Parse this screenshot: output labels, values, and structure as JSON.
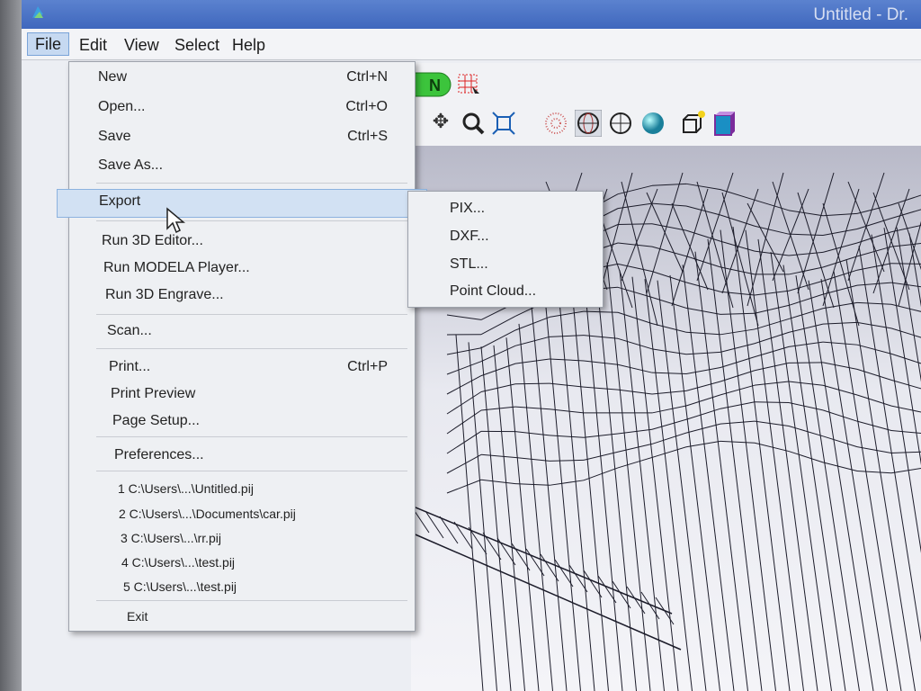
{
  "window": {
    "title": "Untitled - Dr."
  },
  "menubar": {
    "items": [
      "File",
      "Edit",
      "View",
      "Select",
      "Help"
    ],
    "active": "File"
  },
  "file_menu": {
    "items": [
      {
        "label": "New",
        "shortcut": "Ctrl+N"
      },
      {
        "label": "Open...",
        "shortcut": "Ctrl+O"
      },
      {
        "label": "Save",
        "shortcut": "Ctrl+S"
      },
      {
        "label": "Save As...",
        "shortcut": ""
      },
      {
        "label": "Export",
        "shortcut": "",
        "has_submenu": true
      },
      {
        "label": "Run 3D Editor...",
        "shortcut": ""
      },
      {
        "label": "Run MODELA Player...",
        "shortcut": ""
      },
      {
        "label": "Run 3D Engrave...",
        "shortcut": ""
      },
      {
        "label": "Scan...",
        "shortcut": ""
      },
      {
        "label": "Print...",
        "shortcut": "Ctrl+P"
      },
      {
        "label": "Print Preview",
        "shortcut": ""
      },
      {
        "label": "Page Setup...",
        "shortcut": ""
      },
      {
        "label": "Preferences...",
        "shortcut": ""
      },
      {
        "label": "1 C:\\Users\\...\\Untitled.pij",
        "shortcut": ""
      },
      {
        "label": "2 C:\\Users\\...\\Documents\\car.pij",
        "shortcut": ""
      },
      {
        "label": "3 C:\\Users\\...\\rr.pij",
        "shortcut": ""
      },
      {
        "label": "4 C:\\Users\\...\\test.pij",
        "shortcut": ""
      },
      {
        "label": "5 C:\\Users\\...\\test.pij",
        "shortcut": ""
      },
      {
        "label": "Exit",
        "shortcut": ""
      }
    ]
  },
  "export_submenu": {
    "items": [
      "PIX...",
      "DXF...",
      "STL...",
      "Point Cloud..."
    ]
  },
  "toolbar": {
    "row1_icons": [
      "green-start-icon",
      "grid-select-icon"
    ],
    "row2_icons": [
      "move-icon",
      "zoom-icon",
      "fit-icon",
      "point-view-icon",
      "wire-sphere-icon",
      "sphere-outline-icon",
      "solid-sphere-icon",
      "cube-light-icon",
      "box-view-icon"
    ],
    "green_button_text": "N"
  },
  "colors": {
    "titlebar": "#4a72c5",
    "menu_highlight": "#d2e1f3",
    "submenu_bg": "#eef0f3"
  }
}
